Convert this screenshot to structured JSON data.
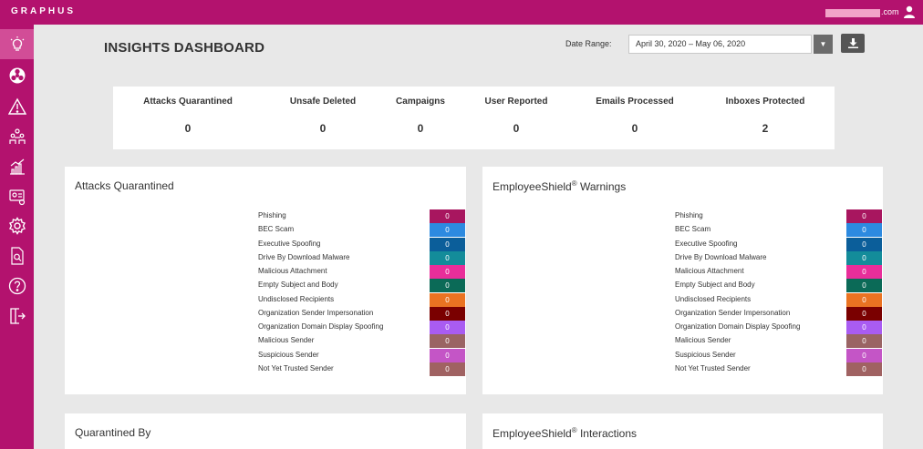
{
  "header": {
    "logo": "GRAPHUS",
    "user_domain": ".com"
  },
  "sidebar": {
    "items": [
      {
        "name": "insights",
        "icon": "lightbulb-icon",
        "active": true
      },
      {
        "name": "biohazard",
        "icon": "biohazard-icon"
      },
      {
        "name": "alerts",
        "icon": "warning-icon"
      },
      {
        "name": "users",
        "icon": "users-icon"
      },
      {
        "name": "reports",
        "icon": "chart-icon"
      },
      {
        "name": "identity",
        "icon": "id-card-icon"
      },
      {
        "name": "settings",
        "icon": "gear-icon"
      },
      {
        "name": "search-docs",
        "icon": "document-search-icon"
      },
      {
        "name": "help",
        "icon": "help-icon"
      },
      {
        "name": "logout",
        "icon": "logout-icon"
      }
    ]
  },
  "main": {
    "title": "INSIGHTS DASHBOARD",
    "date_range_label": "Date Range:",
    "date_range_value": "April 30, 2020 – May 06, 2020"
  },
  "stats": [
    {
      "label": "Attacks Quarantined",
      "value": "0"
    },
    {
      "label": "Unsafe Deleted",
      "value": "0"
    },
    {
      "label": "Campaigns",
      "value": "0"
    },
    {
      "label": "User Reported",
      "value": "0"
    },
    {
      "label": "Emails Processed",
      "value": "0"
    },
    {
      "label": "Inboxes Protected",
      "value": "2"
    }
  ],
  "panels": {
    "attacks_quarantined": {
      "title": "Attacks Quarantined"
    },
    "es_warnings": {
      "title": "EmployeeShield",
      "title_sup": "®",
      "title_suffix": " Warnings"
    },
    "quarantined_by": {
      "title": "Quarantined By"
    },
    "es_interactions": {
      "title": "EmployeeShield",
      "title_sup": "®",
      "title_suffix": " Interactions"
    }
  },
  "legend": [
    {
      "label": "Phishing",
      "value": "0",
      "color": "#a8165f"
    },
    {
      "label": "BEC Scam",
      "value": "0",
      "color": "#2d8ae0"
    },
    {
      "label": "Executive Spoofing",
      "value": "0",
      "color": "#0b5e9a"
    },
    {
      "label": "Drive By Download Malware",
      "value": "0",
      "color": "#138c9a"
    },
    {
      "label": "Malicious Attachment",
      "value": "0",
      "color": "#e92e9a"
    },
    {
      "label": "Empty Subject and Body",
      "value": "0",
      "color": "#0b6a57"
    },
    {
      "label": "Undisclosed Recipients",
      "value": "0",
      "color": "#ea7322"
    },
    {
      "label": "Organization Sender Impersonation",
      "value": "0",
      "color": "#7a0000"
    },
    {
      "label": "Organization Domain Display Spoofing",
      "value": "0",
      "color": "#a95cf2"
    },
    {
      "label": "Malicious Sender",
      "value": "0",
      "color": "#9a6464"
    },
    {
      "label": "Suspicious Sender",
      "value": "0",
      "color": "#c455c6"
    },
    {
      "label": "Not Yet Trusted Sender",
      "value": "0",
      "color": "#a06262"
    }
  ]
}
